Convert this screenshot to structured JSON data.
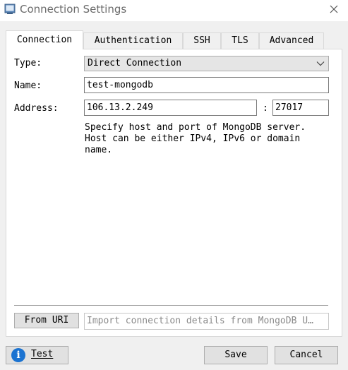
{
  "window": {
    "title": "Connection Settings",
    "app_icon": "window-icon",
    "close_icon": "close-icon"
  },
  "tabs": [
    {
      "label": "Connection",
      "active": true
    },
    {
      "label": "Authentication",
      "active": false
    },
    {
      "label": "SSH",
      "active": false
    },
    {
      "label": "TLS",
      "active": false
    },
    {
      "label": "Advanced",
      "active": false
    }
  ],
  "connection": {
    "type_label": "Type:",
    "type_value": "Direct Connection",
    "dropdown_icon": "chevron-down-icon",
    "name_label": "Name:",
    "name_value": "test-mongodb",
    "address_label": "Address:",
    "host_value": "106.13.2.249",
    "port_separator": ":",
    "port_value": "27017",
    "help_text": "Specify host and port of MongoDB server.\nHost can be either IPv4, IPv6 or domain\nname."
  },
  "uri": {
    "button_label": "From URI",
    "placeholder": "Import connection details from MongoDB U…"
  },
  "footer": {
    "test_label": "Test",
    "test_icon": "info-icon",
    "save_label": "Save",
    "cancel_label": "Cancel"
  },
  "colors": {
    "accent": "#1b73d1",
    "panel_bg": "#ffffff",
    "window_bg": "#f0f0f0"
  }
}
